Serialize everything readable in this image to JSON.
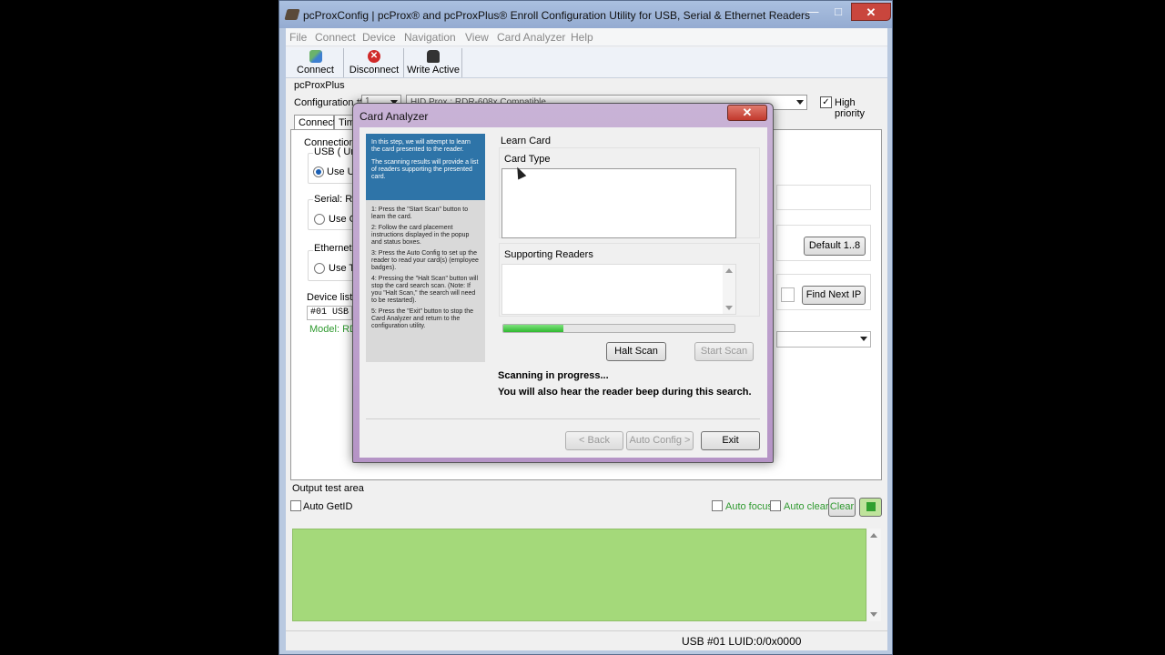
{
  "window": {
    "title": "pcProxConfig |  pcProx® and pcProxPlus® Enroll Configuration Utility for USB, Serial & Ethernet Readers",
    "min_glyph": "—",
    "max_glyph": "□",
    "close_glyph": "✕"
  },
  "menu": [
    "File",
    "Connect",
    "Device",
    "Navigation",
    "View",
    "Card Analyzer",
    "Help"
  ],
  "toolbar": {
    "connect_label": "Connect",
    "disconnect_label": "Disconnect",
    "write_active_label": "Write Active"
  },
  "device": {
    "name": "pcProxPlus",
    "config_label": "Configuration #",
    "config_value": "1",
    "reader_type": "HID Prox : RDR-608x Compatible",
    "high_priority_label": "High priority"
  },
  "tabs": [
    "Connect",
    "Tim"
  ],
  "connect_panel": {
    "connection_label": "Connection t",
    "usb_group": "USB ( Univ",
    "use_usb_label": "Use US",
    "serial_group": "Serial: RS",
    "use_com_label": "Use CO",
    "ethernet_group": "Ethernet (",
    "use_tcp_label": "Use TC",
    "default_button": "Default 1..8",
    "find_next_ip_button": "Find Next IP",
    "device_list_label": "Device list",
    "device_list_value": "#01 USB",
    "model_label": "Model: RDR"
  },
  "output": {
    "label": "Output test area",
    "auto_getid_label": "Auto GetID",
    "auto_focus_label": "Auto focus",
    "auto_clear_label": "Auto clear",
    "clear_button": "Clear",
    "area_color": "#a4d97a"
  },
  "status_bar": {
    "text": "USB #01 LUID:0/0x0000"
  },
  "dialog": {
    "title": "Card Analyzer",
    "close_glyph": "✕",
    "instructions_intro": [
      "In this step, we will attempt to learn the card presented to the reader.",
      "The scanning results will provide a list of readers supporting the presented card."
    ],
    "instructions_steps": [
      "1: Press the \"Start Scan\" button to learn the card.",
      "2: Follow the card placement instructions displayed in the popup and status boxes.",
      "3: Press the Auto Config to set up the reader to read your card(s) (employee badges).",
      "4: Pressing the \"Halt Scan\" button will stop the card search scan. (Note: If you \"Halt Scan,\" the search will need to be restarted).",
      "5: Press the \"Exit\" button to stop the Card Analyzer and return to the configuration utility."
    ],
    "learn_card_label": "Learn Card",
    "card_type_label": "Card Type",
    "supporting_readers_label": "Supporting Readers",
    "progress": 0.26,
    "halt_scan_button": "Halt Scan",
    "start_scan_button": "Start Scan",
    "status_line1": "Scanning in progress...",
    "status_line2": "You will also hear the reader beep during this search.",
    "back_button": "< Back",
    "auto_config_button": "Auto Config >",
    "exit_button": "Exit"
  }
}
